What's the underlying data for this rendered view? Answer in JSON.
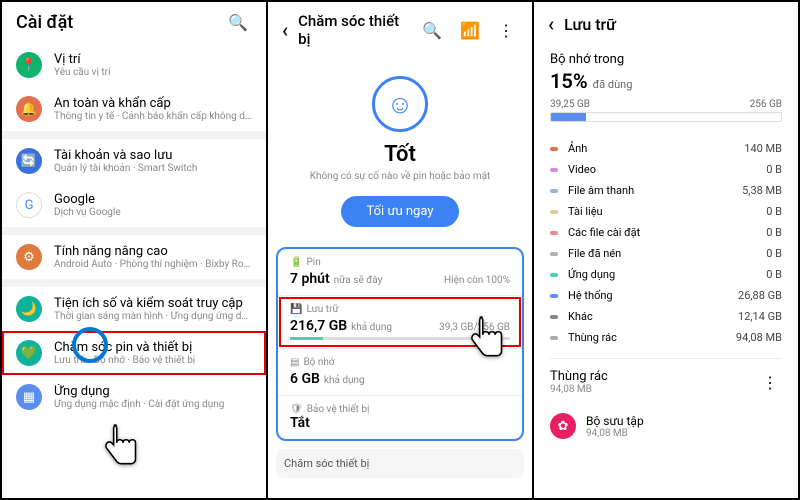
{
  "screen1": {
    "title": "Cài đặt",
    "items": [
      {
        "icon_bg": "#0fb36b",
        "glyph": "📍",
        "title": "Vị trí",
        "sub": "Yêu cầu vị trí"
      },
      {
        "icon_bg": "#e36f4c",
        "glyph": "🔔",
        "title": "An toàn và khẩn cấp",
        "sub": "Thông tin y tế · Cảnh báo khẩn cấp không dây"
      }
    ],
    "items2": [
      {
        "icon_bg": "#3b6fe0",
        "glyph": "🔄",
        "title": "Tài khoản và sao lưu",
        "sub": "Quản lý tài khoản · Smart Switch"
      },
      {
        "icon_bg": "#fff",
        "glyph": "G",
        "title": "Google",
        "sub": "Dịch vụ Google",
        "text_color": "#4285f4"
      }
    ],
    "items3": [
      {
        "icon_bg": "#e07a3b",
        "glyph": "⚙",
        "title": "Tính năng nâng cao",
        "sub": "Android Auto · Phòng thí nghiệm · Bixby Routines"
      }
    ],
    "items4": [
      {
        "icon_bg": "#0fb39c",
        "glyph": "🌙",
        "title": "Tiện ích số và kiểm soát truy cập",
        "sub": "Thời gian sáng màn hình · Ứng dụng ứng dụng · Chế độ Ngủ"
      },
      {
        "icon_bg": "#0fb39c",
        "glyph": "💚",
        "title": "Chăm sóc pin và thiết bị",
        "sub": "Lưu trữ · Bộ nhớ · Bảo vệ thiết bị"
      },
      {
        "icon_bg": "#5b8def",
        "glyph": "▦",
        "title": "Ứng dụng",
        "sub": "Ứng dụng mặc định · Cài đặt ứng dụng"
      }
    ]
  },
  "screen2": {
    "title": "Chăm sóc thiết bị",
    "status": "Tốt",
    "status_sub": "Không có sự cố nào về pin hoặc bảo mật",
    "optimize": "Tối ưu ngay",
    "battery": {
      "label": "Pin",
      "time": "7 phút",
      "time_sub": "nữa sẽ đây",
      "right": "Hiện còn 100%"
    },
    "storage": {
      "label": "Lưu trữ",
      "value": "216,7 GB",
      "value_sub": "khả dụng",
      "right": "39,3 GB/256 GB"
    },
    "memory": {
      "label": "Bộ nhớ",
      "value": "6 GB",
      "value_sub": "khả dụng"
    },
    "protect": {
      "label": "Bảo vệ thiết bị",
      "value": "Tắt"
    },
    "footer": "Chăm sóc thiết bị"
  },
  "screen3": {
    "title": "Lưu trữ",
    "heading": "Bộ nhớ trong",
    "pct": "15%",
    "pct_sub": "đã dùng",
    "used": "39,25 GB",
    "total": "256 GB",
    "categories": [
      {
        "color": "#e36f4c",
        "name": "Ảnh",
        "val": "140 MB"
      },
      {
        "color": "#d48fd6",
        "name": "Video",
        "val": "0 B"
      },
      {
        "color": "#8fb6e0",
        "name": "File âm thanh",
        "val": "5,38 MB"
      },
      {
        "color": "#e0c88f",
        "name": "Tài liệu",
        "val": "0 B"
      },
      {
        "color": "#e08f8f",
        "name": "Các file cài đặt",
        "val": "0 B"
      },
      {
        "color": "#b0b0b0",
        "name": "File đã nén",
        "val": "0 B"
      },
      {
        "color": "#4dd0b0",
        "name": "Ứng dụng",
        "val": "0 B"
      },
      {
        "color": "#5b8def",
        "name": "Hệ thống",
        "val": "26,88 GB"
      },
      {
        "color": "#888",
        "name": "Khác",
        "val": "12,14 GB"
      },
      {
        "color": "#aaa",
        "name": "Thùng rác",
        "val": "94,08 MB"
      }
    ],
    "trash": {
      "label": "Thùng rác",
      "size": "94,08 MB"
    },
    "collection": {
      "label": "Bộ sưu tập",
      "size": "94,08 MB"
    }
  }
}
